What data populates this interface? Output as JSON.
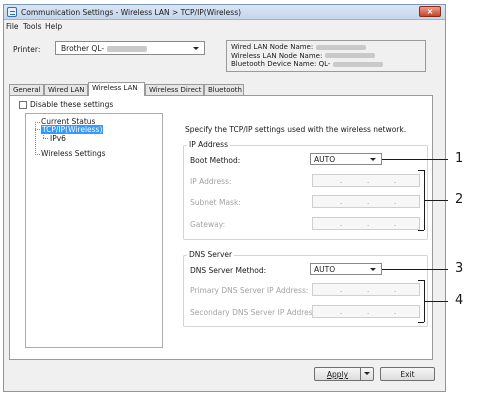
{
  "window": {
    "title": "Communication Settings - Wireless LAN > TCP/IP(Wireless)",
    "close_glyph": "×"
  },
  "menu": {
    "items": [
      "File",
      "Tools",
      "Help"
    ]
  },
  "printer": {
    "label": "Printer:",
    "selected": "Brother QL-"
  },
  "node_info": {
    "lines": [
      "Wired LAN Node Name:",
      "Wireless LAN Node Name:",
      "Bluetooth Device Name: QL-"
    ]
  },
  "tabs": [
    {
      "label": "General",
      "active": false
    },
    {
      "label": "Wired LAN",
      "active": false
    },
    {
      "label": "Wireless LAN",
      "active": true
    },
    {
      "label": "Wireless Direct",
      "active": false
    },
    {
      "label": "Bluetooth",
      "active": false
    }
  ],
  "disable_settings": {
    "label": "Disable these settings",
    "checked": false
  },
  "tree": {
    "items": [
      {
        "label": "Current Status"
      },
      {
        "label": "TCP/IP(Wireless)",
        "selected": true
      },
      {
        "label": "IPv6"
      },
      {
        "label": "Wireless Settings"
      }
    ]
  },
  "main": {
    "description": "Specify the TCP/IP settings used with the wireless network.",
    "ip_group": {
      "title": "IP Address",
      "boot_method_label": "Boot Method:",
      "boot_method_value": "AUTO",
      "ip_label": "IP Address:",
      "subnet_label": "Subnet Mask:",
      "gateway_label": "Gateway:"
    },
    "dns_group": {
      "title": "DNS Server",
      "method_label": "DNS Server Method:",
      "method_value": "AUTO",
      "primary_label": "Primary DNS Server IP Address:",
      "secondary_label": "Secondary DNS Server IP Address:"
    },
    "ip_separator": "."
  },
  "callouts": [
    "1",
    "2",
    "3",
    "4"
  ],
  "buttons": {
    "apply": "Apply",
    "exit": "Exit"
  }
}
